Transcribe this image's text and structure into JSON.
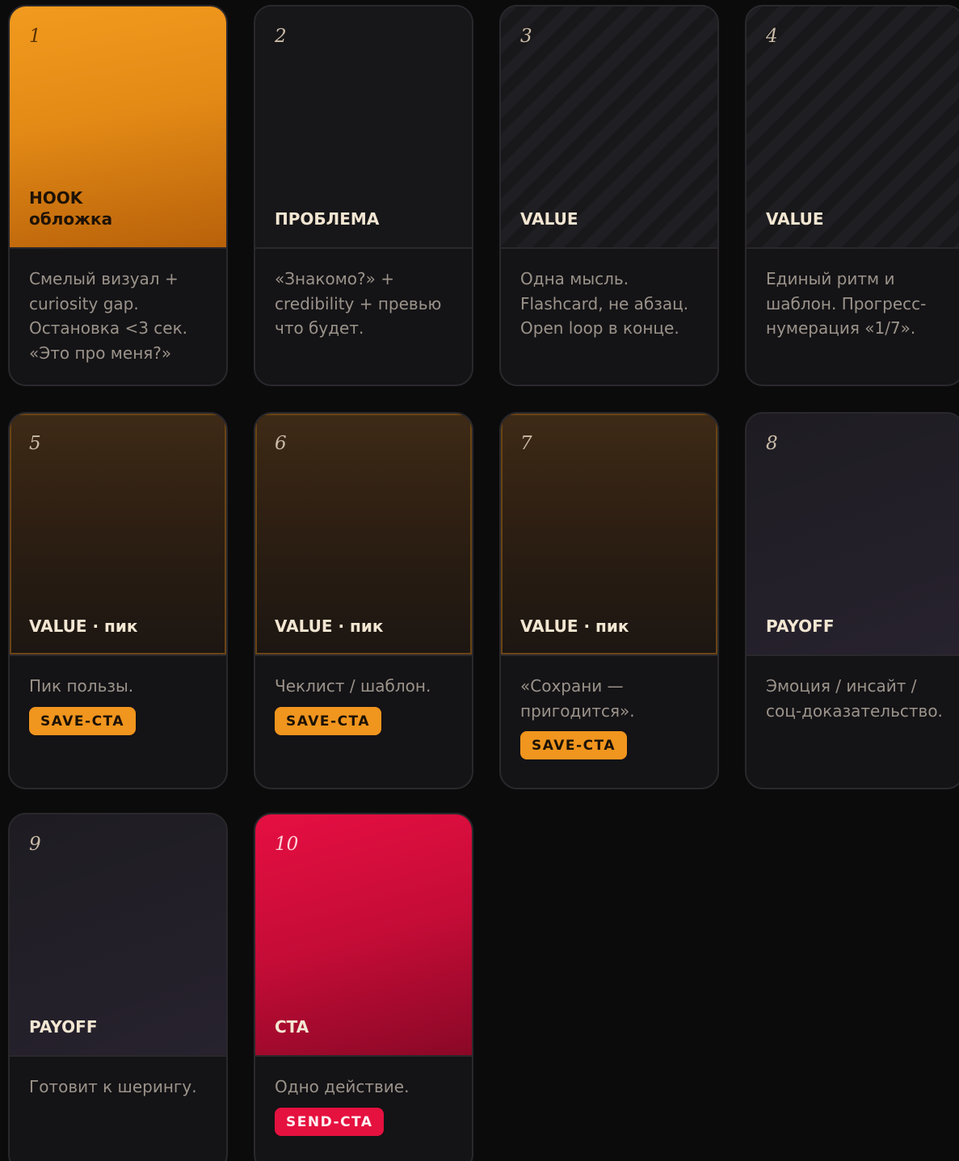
{
  "cards": [
    {
      "number": "1",
      "label": "HOOK\nобложка",
      "description": "Смелый визуал + curiosity gap. Остановка <3 сек. «Это про меня?»",
      "badge": ""
    },
    {
      "number": "2",
      "label": "ПРОБЛЕМА",
      "description": "«Знакомо?» + credibility + превью что будет.",
      "badge": ""
    },
    {
      "number": "3",
      "label": "VALUE",
      "description": "Одна мысль. Flashcard, не абзац. Open loop в конце.",
      "badge": ""
    },
    {
      "number": "4",
      "label": "VALUE",
      "description": "Единый ритм и шаблон. Прогресс-нумерация «1/7».",
      "badge": ""
    },
    {
      "number": "5",
      "label": "VALUE · пик",
      "description": "Пик пользы.",
      "badge": "SAVE-CTA"
    },
    {
      "number": "6",
      "label": "VALUE · пик",
      "description": "Чеклист / шаблон.",
      "badge": "SAVE-CTA"
    },
    {
      "number": "7",
      "label": "VALUE · пик",
      "description": "«Сохрани — пригодится».",
      "badge": "SAVE-CTA"
    },
    {
      "number": "8",
      "label": "PAYOFF",
      "description": "Эмоция / инсайт / соц-доказательство.",
      "badge": ""
    },
    {
      "number": "9",
      "label": "PAYOFF",
      "description": "Готовит к шерингу.",
      "badge": ""
    },
    {
      "number": "10",
      "label": "CTA",
      "description": "Одно действие.",
      "badge": "SEND-CTA"
    }
  ],
  "colors": {
    "background": "#0b0b0c",
    "hook": "#f29a1e",
    "save_badge": "#f0951e",
    "cta": "#e60f42",
    "send_badge": "#e5113f"
  }
}
